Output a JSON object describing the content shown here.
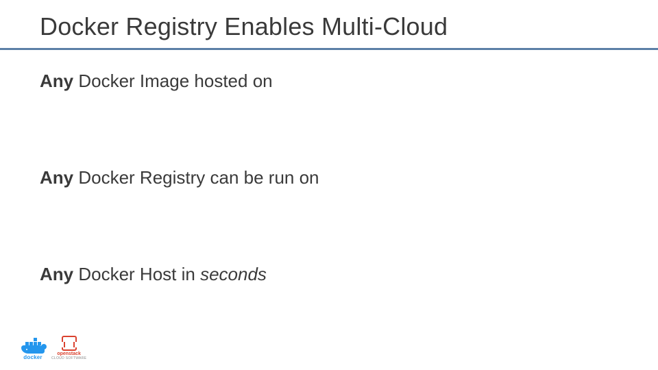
{
  "title": "Docker Registry Enables Multi-Cloud",
  "lines": {
    "l1": {
      "bold": "Any",
      "rest": " Docker Image hosted on"
    },
    "l2": {
      "bold": "Any",
      "rest": " Docker Registry can be run on"
    },
    "l3": {
      "bold": "Any",
      "rest_a": " Docker Host in ",
      "italic": "seconds"
    }
  },
  "footer": {
    "docker_label": "docker",
    "openstack_label": "openstack",
    "openstack_sub": "CLOUD SOFTWARE"
  }
}
